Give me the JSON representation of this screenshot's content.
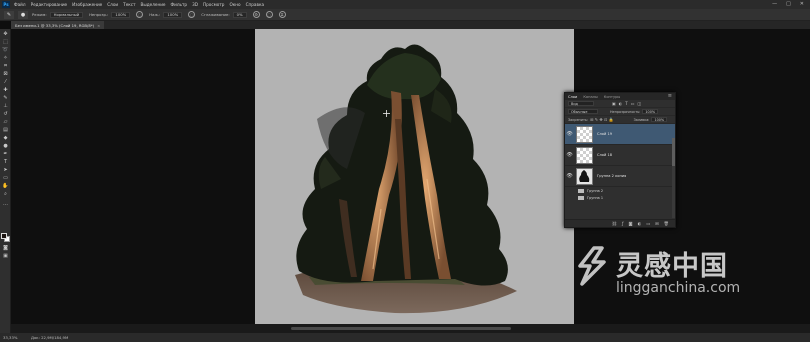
{
  "app": {
    "logo": "Ps"
  },
  "menu": [
    "Файл",
    "Редактирование",
    "Изображение",
    "Слои",
    "Текст",
    "Выделение",
    "Фильтр",
    "3D",
    "Просмотр",
    "Окно",
    "Справка"
  ],
  "window_controls": [
    "—",
    "□",
    "✕"
  ],
  "options": {
    "mode_label": "Режим:",
    "mode_value": "Нормальный",
    "opacity_label": "Непрозр.:",
    "opacity_value": "100%",
    "flow_label": "Наж.:",
    "flow_value": "100%",
    "smoothing_label": "Сглаживание:",
    "smoothing_value": "0%"
  },
  "document_tab": {
    "title": "Без имени-1 @ 33,3% (Слой 19, RGB/8*)",
    "close": "×"
  },
  "status": {
    "zoom": "33,33%",
    "info": "Док: 22,9М/184,9М"
  },
  "layers_panel": {
    "tabs": [
      "Слои",
      "Каналы",
      "Контуры"
    ],
    "menu": "≡",
    "filter_value": "Вид",
    "blend_mode": "Обычные",
    "opacity_label": "Непрозрачность:",
    "opacity_value": "100%",
    "lock_label": "Закрепить:",
    "fill_label": "Заливка:",
    "fill_value": "100%",
    "layers": [
      {
        "name": "Слой 19",
        "selected": true
      },
      {
        "name": "Слой 18",
        "selected": false
      },
      {
        "name": "Группа 2 копия",
        "selected": false
      }
    ],
    "groups": [
      "Группа 2",
      "Группа 1"
    ],
    "footer_icons": [
      "link-icon",
      "fx-icon",
      "mask-icon",
      "adjustment-icon",
      "folder-icon",
      "new-layer-icon",
      "trash-icon"
    ]
  },
  "watermark": {
    "title": "灵感中国",
    "url": "lingganchina.com"
  },
  "colors": {
    "accent": "#3f5973",
    "canvas": "#b3b3b3",
    "workspace": "#0f0f0f"
  }
}
